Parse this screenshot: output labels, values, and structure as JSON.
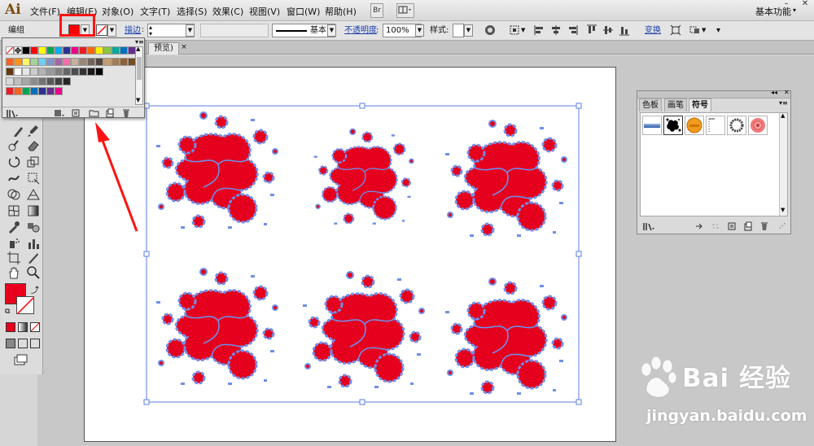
{
  "app": {
    "logo": "Ai",
    "workspace": "基本功能"
  },
  "menu": [
    "文件(F)",
    "编辑(E)",
    "对象(O)",
    "文字(T)",
    "选择(S)",
    "效果(C)",
    "视图(V)",
    "窗口(W)",
    "帮助(H)"
  ],
  "menubar_buttons": {
    "bridge": "Br"
  },
  "control_bar": {
    "selection_type": "编组",
    "stroke_link": "描边",
    "stroke_style": "基本",
    "opacity_link": "不透明度",
    "opacity_value": "100%",
    "style_label": "样式:",
    "transform_link": "变换"
  },
  "document_tab": {
    "title": "预览)",
    "close": "×"
  },
  "fill_color": "#ff0000",
  "swatch_colors": [
    [
      "#ffffff",
      "#ffffff",
      "#000000",
      "#ff0000",
      "#ffff00",
      "#00a651",
      "#00aeef",
      "#2e3192",
      "#ec008c",
      "#ed1c24",
      "#ff6600",
      "#fff200",
      "#8dc63f",
      "#00a99d",
      "#0072bc",
      "#662d91"
    ],
    [
      "#f26522",
      "#f7941d",
      "#fff568",
      "#a3d39c",
      "#6dcff6",
      "#8393ca",
      "#a864a8",
      "#f06eaa",
      "#c7b299",
      "#998675",
      "#736357",
      "#534741",
      "#c69c6d",
      "#a67c52",
      "#8c6239",
      "#754c24"
    ],
    [
      "#603913",
      "#ffffff",
      "#e6e6e6",
      "#cccccc",
      "#b3b3b3",
      "#999999",
      "#808080",
      "#666666",
      "#4d4d4d",
      "#333333",
      "#1a1a1a",
      "#000000"
    ],
    [
      "#d9d9d9",
      "#bfbfbf",
      "#a6a6a6",
      "#8c8c8c",
      "#737373",
      "#595959",
      "#404040",
      "#262626"
    ],
    [
      "#ed1c24",
      "#f26522",
      "#00a651",
      "#0072bc",
      "#2e3192",
      "#662d91",
      "#ec008c"
    ]
  ],
  "symbols_panel": {
    "tabs": [
      "色板",
      "画笔",
      "符号"
    ],
    "symbol_icons": [
      "blue-bar-symbol",
      "ink-splat-symbol",
      "orange-button-symbol",
      "dotted-frame-symbol",
      "wreath-symbol",
      "pink-flower-symbol"
    ]
  },
  "watermark": {
    "brand": "Bai 经验",
    "url": "jingyan.baidu.com"
  }
}
